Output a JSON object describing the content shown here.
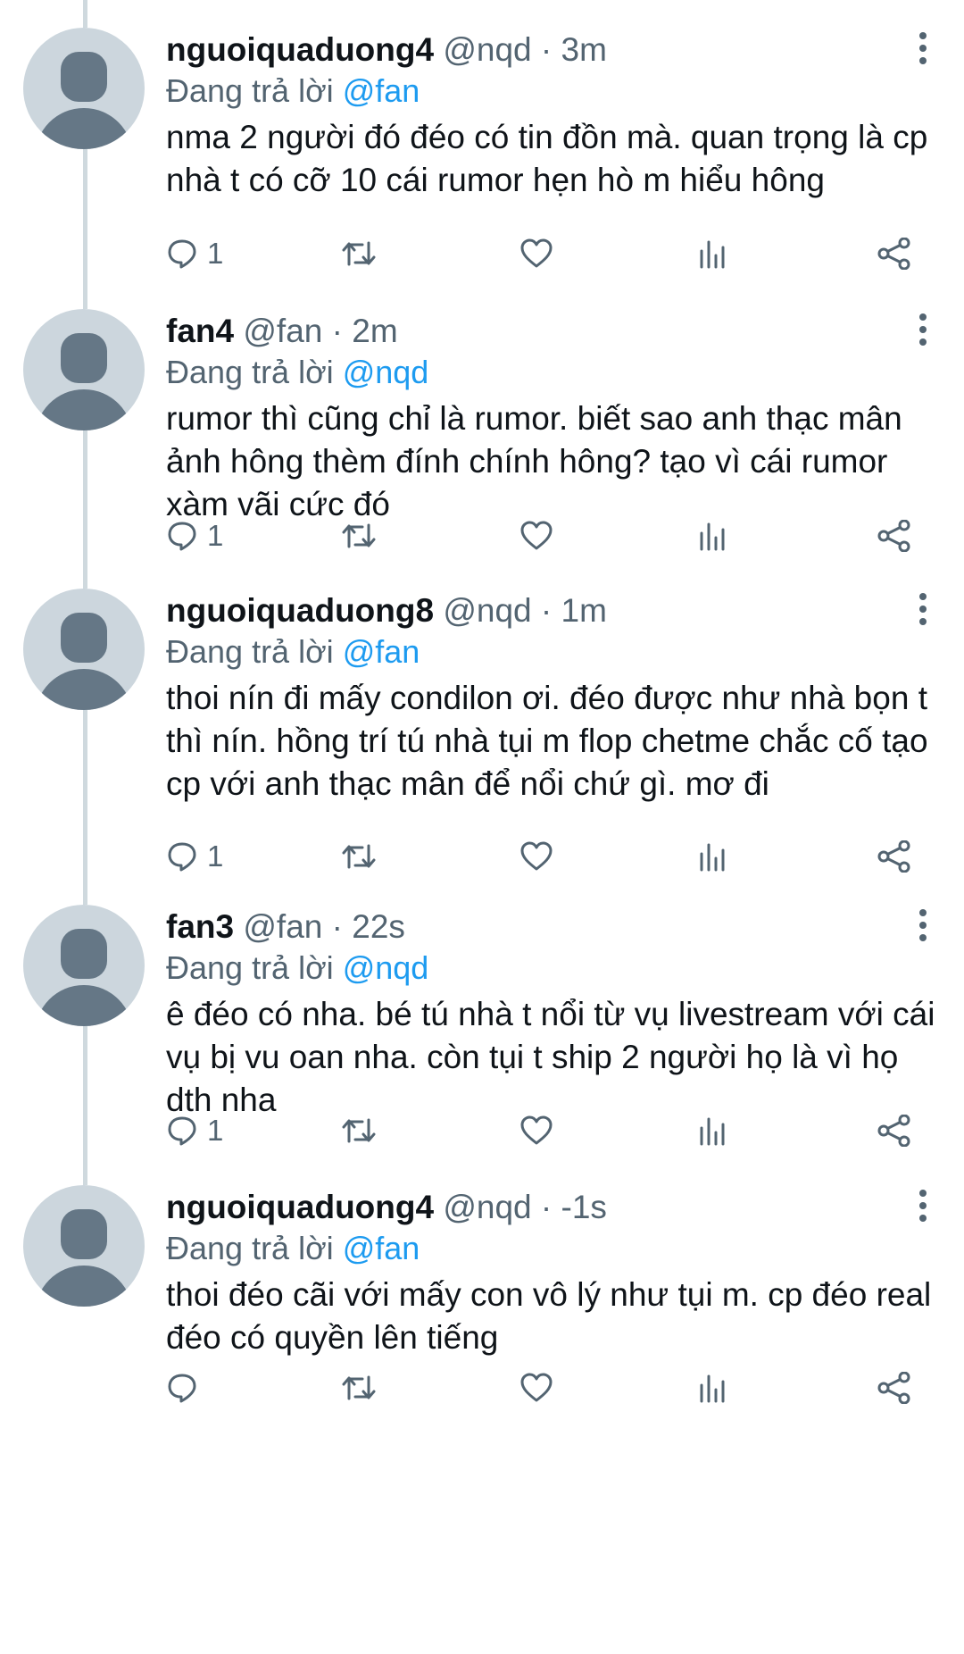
{
  "tweets": [
    {
      "display_name": "nguoiquaduong4",
      "handle": "@nqd",
      "dot": "·",
      "time": "3m",
      "replying_prefix": "Đang trả lời",
      "replying_to": "@fan",
      "text": "nma 2 người đó đéo có tin đồn mà. quan trọng là cp nhà t có cỡ 10 cái rumor hẹn hò m hiểu hông",
      "reply_count": "1"
    },
    {
      "display_name": "fan4",
      "handle": "@fan",
      "dot": "·",
      "time": "2m",
      "replying_prefix": "Đang trả lời",
      "replying_to": "@nqd",
      "text": "rumor thì cũng chỉ là rumor. biết sao anh thạc mân ảnh hông thèm đính chính hông? tạo vì cái rumor xàm vãi cức đó",
      "reply_count": "1"
    },
    {
      "display_name": "nguoiquaduong8",
      "handle": "@nqd",
      "dot": "·",
      "time": "1m",
      "replying_prefix": "Đang trả lời",
      "replying_to": "@fan",
      "text": "thoi nín đi mấy condilon ơi. đéo được như nhà bọn t thì nín. hồng trí tú nhà tụi m flop chetme chắc cố tạo cp với anh thạc mân để nổi chứ gì. mơ đi",
      "reply_count": "1"
    },
    {
      "display_name": "fan3",
      "handle": "@fan",
      "dot": "·",
      "time": "22s",
      "replying_prefix": "Đang trả lời",
      "replying_to": "@nqd",
      "text": "ê đéo có nha. bé tú nhà t nổi từ vụ livestream với cái vụ bị vu oan nha. còn tụi t ship 2 người họ là vì họ dth nha",
      "reply_count": "1"
    },
    {
      "display_name": "nguoiquaduong4",
      "handle": "@nqd",
      "dot": "·",
      "time": "-1s",
      "replying_prefix": "Đang trả lời",
      "replying_to": "@fan",
      "text": "thoi đéo cãi với mấy con vô lý như tụi m. cp đéo real đéo có quyền lên tiếng",
      "reply_count": ""
    }
  ],
  "icons": {
    "avatar": "default-avatar-icon",
    "more": "more-vertical-icon",
    "reply": "reply-bubble-icon",
    "retweet": "retweet-icon",
    "like": "heart-icon",
    "views": "bar-chart-icon",
    "share": "share-icon"
  },
  "colors": {
    "text": "#0f1419",
    "muted": "#536471",
    "mention": "#1d9bf0",
    "thread_line": "#cfd9de",
    "avatar_bg": "#ccd6dd",
    "avatar_fg": "#657786"
  }
}
